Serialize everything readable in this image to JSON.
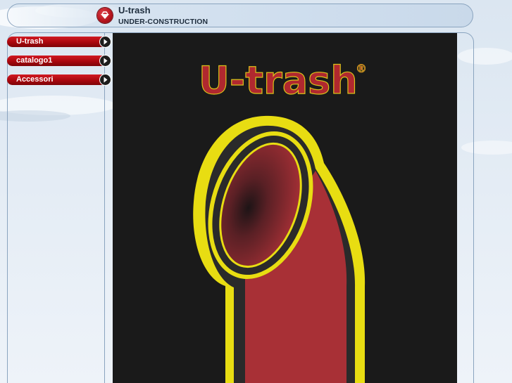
{
  "header": {
    "title": "U-trash",
    "subtitle": "UNDER-CONSTRUCTION",
    "logo_icon": "brand-badge-icon"
  },
  "sidebar": {
    "items": [
      {
        "label": "U-trash",
        "icon": "arrow-right-icon"
      },
      {
        "label": "catalogo1",
        "icon": "arrow-right-icon"
      },
      {
        "label": "Accessori",
        "icon": "arrow-right-icon"
      }
    ]
  },
  "main": {
    "brand_text": "U-trash",
    "registered_mark": "®"
  },
  "colors": {
    "accent_red": "#b3121b",
    "bin_red": "#a83036",
    "bin_outline": "#e8dd12",
    "panel_black": "#1a1a1a"
  }
}
